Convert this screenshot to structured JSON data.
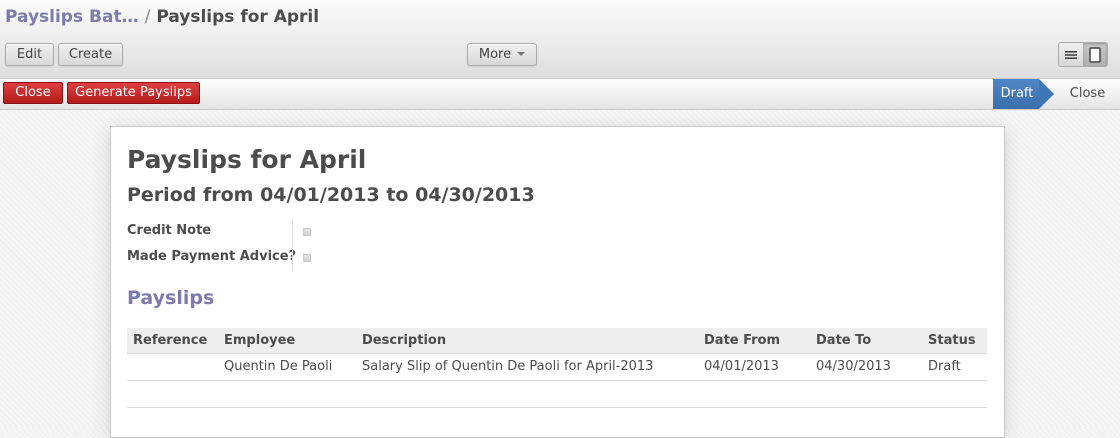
{
  "breadcrumb": {
    "parent": "Payslips Bat…",
    "separator": "/",
    "current": "Payslips for April"
  },
  "toolbar": {
    "edit_label": "Edit",
    "create_label": "Create",
    "more_label": "More"
  },
  "view_switcher": {
    "list_icon": "list-icon",
    "form_icon": "form-icon",
    "active": "form"
  },
  "statusbar": {
    "close_label": "Close",
    "generate_label": "Generate Payslips",
    "stages": [
      "Draft",
      "Close"
    ],
    "active_stage": "Draft",
    "active_color": "#4a80c0",
    "button_color": "#c9302c"
  },
  "form": {
    "title": "Payslips for April",
    "period": "Period from 04/01/2013 to 04/30/2013",
    "fields": {
      "credit_note_label": "Credit Note",
      "credit_note_checked": false,
      "payment_advice_label": "Made Payment Advice?",
      "payment_advice_checked": false
    },
    "section_title": "Payslips",
    "table": {
      "columns": [
        "Reference",
        "Employee",
        "Description",
        "Date From",
        "Date To",
        "Status"
      ],
      "rows": [
        {
          "reference": "",
          "employee": "Quentin De Paoli",
          "description": "Salary Slip of Quentin De Paoli for April-2013",
          "date_from": "04/01/2013",
          "date_to": "04/30/2013",
          "status": "Draft"
        }
      ]
    }
  }
}
